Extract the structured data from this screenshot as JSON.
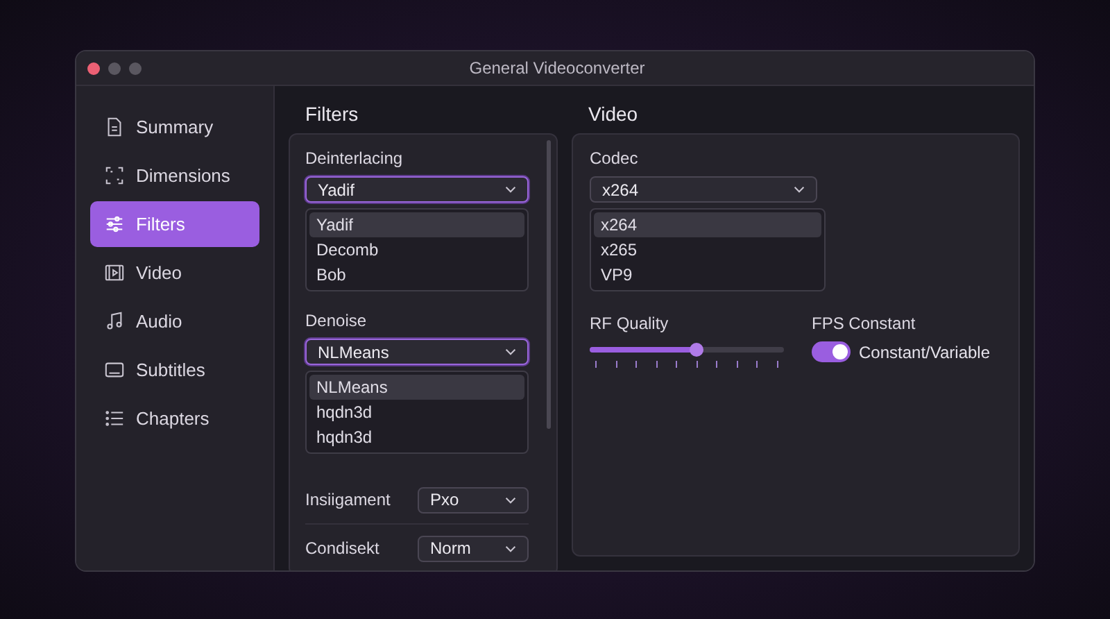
{
  "window": {
    "title": "General Videoconverter"
  },
  "sidebar": {
    "items": [
      {
        "label": "Summary",
        "selected": false
      },
      {
        "label": "Dimensions",
        "selected": false
      },
      {
        "label": "Filters",
        "selected": true
      },
      {
        "label": "Video",
        "selected": false
      },
      {
        "label": "Audio",
        "selected": false
      },
      {
        "label": "Subtitles",
        "selected": false
      },
      {
        "label": "Chapters",
        "selected": false
      }
    ]
  },
  "filters": {
    "title": "Filters",
    "dropdowns": [
      {
        "label": "Deinterlacing",
        "value": "Yadif",
        "focused": true,
        "options": [
          {
            "label": "Yadif",
            "selected": true
          },
          {
            "label": "Decomb",
            "selected": false
          },
          {
            "label": "Bob",
            "selected": false
          }
        ]
      },
      {
        "label": "Denoise",
        "value": "NLMeans",
        "focused": true,
        "options": [
          {
            "label": "NLMeans",
            "selected": true
          },
          {
            "label": "hqdn3d",
            "selected": false
          },
          {
            "label": "hqdn3d",
            "selected": false
          }
        ]
      }
    ],
    "rows": [
      {
        "label": "Insiigament",
        "value": "Pxo"
      },
      {
        "label": "Condisekt",
        "value": "Norm"
      }
    ]
  },
  "video": {
    "title": "Video",
    "codec": {
      "label": "Codec",
      "value": "x264",
      "focused": false,
      "options": [
        {
          "label": "x264",
          "selected": true
        },
        {
          "label": "x265",
          "selected": false
        },
        {
          "label": "VP9",
          "selected": false
        }
      ]
    },
    "rf_quality": {
      "label": "RF Quality",
      "level": 0.55
    },
    "fps": {
      "label": "FPS Constant",
      "toggle_label": "Constant/Variable",
      "on": true
    }
  }
}
